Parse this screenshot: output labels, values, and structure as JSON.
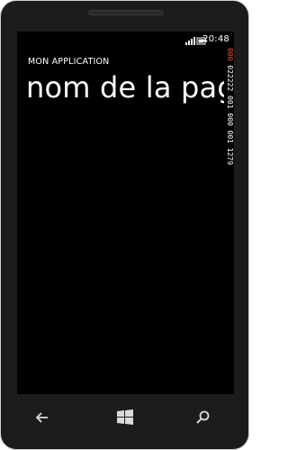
{
  "status_bar": {
    "time": "20:48",
    "icons": [
      "signal-icon",
      "battery-icon"
    ]
  },
  "app": {
    "title": "MON APPLICATION",
    "page_title": "nom de la page"
  },
  "frame_counter": {
    "accent_segment": "000",
    "rest_segment": "022222 001 000 001 1279"
  },
  "nav": {
    "buttons": [
      "back-icon",
      "windows-start-icon",
      "search-icon"
    ]
  },
  "colors": {
    "screen_background": "#000000",
    "frame": "#1c1c1c",
    "accent": "#e8502e",
    "text": "#ffffff"
  }
}
